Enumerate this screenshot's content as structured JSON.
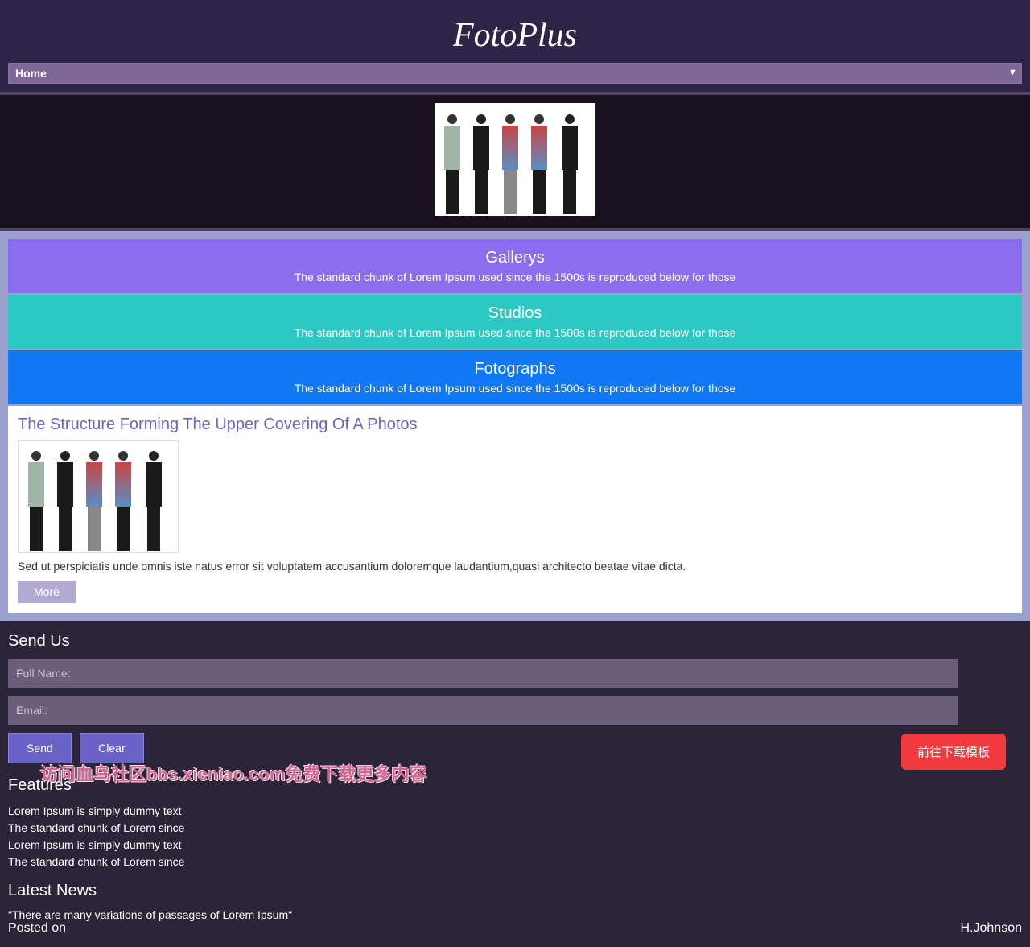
{
  "header": {
    "logo": "FotoPlus",
    "nav_selected": "Home"
  },
  "categories": [
    {
      "title": "Gallerys",
      "desc": "The standard chunk of Lorem Ipsum used since the 1500s is reproduced below for those"
    },
    {
      "title": "Studios",
      "desc": "The standard chunk of Lorem Ipsum used since the 1500s is reproduced below for those"
    },
    {
      "title": "Fotographs",
      "desc": "The standard chunk of Lorem Ipsum used since the 1500s is reproduced below for those"
    }
  ],
  "article": {
    "title": "The Structure Forming The Upper Covering Of A Photos",
    "body": "Sed ut perspiciatis unde omnis iste natus error sit voluptatem accusantium doloremque laudantium,quasi architecto beatae vitae dicta.",
    "more": "More"
  },
  "form": {
    "title": "Send Us",
    "name_placeholder": "Full Name:",
    "email_placeholder": "Email:",
    "send": "Send",
    "clear": "Clear"
  },
  "features": {
    "title": "Features",
    "items": [
      "Lorem Ipsum is simply dummy text",
      "The standard chunk of Lorem since",
      "Lorem Ipsum is simply dummy text",
      "The standard chunk of Lorem since"
    ]
  },
  "latest": {
    "title": "Latest News",
    "quote": "\"There are many variations of passages of Lorem Ipsum\"",
    "posted": "Posted on",
    "author": "H.Johnson"
  },
  "download_btn": "前往下载模板",
  "watermark": "访问血鸟社区bbs.xieniao.com免费下载更多内容"
}
